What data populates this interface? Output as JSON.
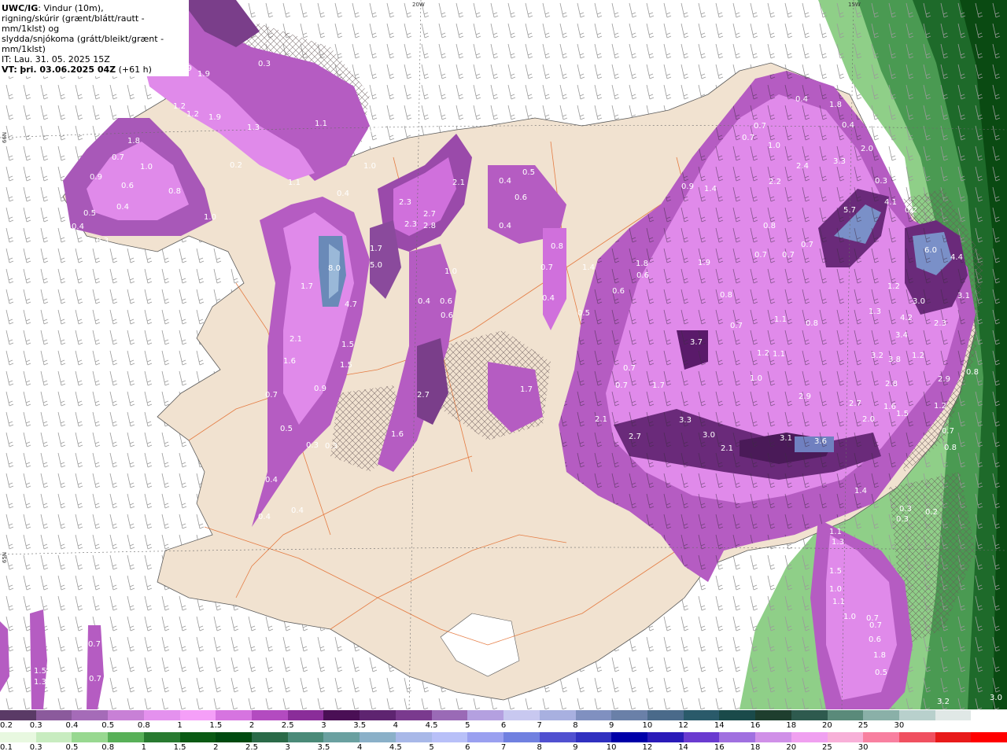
{
  "header": {
    "model": "UWC/IG",
    "line1_rest": ": Vindur (10m),",
    "line2": "rigning/skúrir (grænt/blátt/rautt - mm/1klst) og",
    "line3": "slydda/snjókoma (grátt/bleikt/grænt - mm/1klst)",
    "it_label": "IT:",
    "it_value": "Lau. 31. 05. 2025 15Z",
    "vt_label": "VT:",
    "vt_value": "þri. 03.06.2025 04Z",
    "vt_offset": "(+61 h)"
  },
  "graticule_labels": [
    "20W",
    "15W",
    "66N",
    "65N"
  ],
  "precip_values": [
    {
      "v": "0.3"
    },
    {
      "v": "1.9"
    },
    {
      "v": "1.9"
    },
    {
      "v": "1.2"
    },
    {
      "v": "1.2"
    },
    {
      "v": "1.9"
    },
    {
      "v": "1.3"
    },
    {
      "v": "1.1"
    },
    {
      "v": "0.9"
    },
    {
      "v": "1.8"
    },
    {
      "v": "0.7"
    },
    {
      "v": "1.0"
    },
    {
      "v": "0.9"
    },
    {
      "v": "0.6"
    },
    {
      "v": "0.8"
    },
    {
      "v": "0.2"
    },
    {
      "v": "1.1"
    },
    {
      "v": "0.5"
    },
    {
      "v": "0.4"
    },
    {
      "v": "0.4"
    },
    {
      "v": "0.3"
    },
    {
      "v": "1.0"
    },
    {
      "v": "1.0"
    },
    {
      "v": "0.4"
    },
    {
      "v": "2.3"
    },
    {
      "v": "2.7"
    },
    {
      "v": "2.3"
    },
    {
      "v": "2.8"
    },
    {
      "v": "2.1"
    },
    {
      "v": "0.4"
    },
    {
      "v": "0.5"
    },
    {
      "v": "0.6"
    },
    {
      "v": "0.4"
    },
    {
      "v": "8.0"
    },
    {
      "v": "4.7"
    },
    {
      "v": "5.0"
    },
    {
      "v": "1.7"
    },
    {
      "v": "1.7"
    },
    {
      "v": "2.1"
    },
    {
      "v": "1.6"
    },
    {
      "v": "1.5"
    },
    {
      "v": "1.5"
    },
    {
      "v": "0.9"
    },
    {
      "v": "0.7"
    },
    {
      "v": "0.5"
    },
    {
      "v": "0.3"
    },
    {
      "v": "0.3"
    },
    {
      "v": "0.4"
    },
    {
      "v": "0.4"
    },
    {
      "v": "0.4"
    },
    {
      "v": "1.0"
    },
    {
      "v": "0.4"
    },
    {
      "v": "0.6"
    },
    {
      "v": "0.6"
    },
    {
      "v": "2.7"
    },
    {
      "v": "1.6"
    },
    {
      "v": "1.7"
    },
    {
      "v": "0.8"
    },
    {
      "v": "0.7"
    },
    {
      "v": "0.4"
    },
    {
      "v": "1.4"
    },
    {
      "v": "0.5"
    },
    {
      "v": "0.6"
    },
    {
      "v": "1.8"
    },
    {
      "v": "0.6"
    },
    {
      "v": "0.9"
    },
    {
      "v": "1.4"
    },
    {
      "v": "1.9"
    },
    {
      "v": "0.8"
    },
    {
      "v": "0.7"
    },
    {
      "v": "1.1"
    },
    {
      "v": "0.8"
    },
    {
      "v": "3.7"
    },
    {
      "v": "0.7"
    },
    {
      "v": "0.7"
    },
    {
      "v": "1.7"
    },
    {
      "v": "2.1"
    },
    {
      "v": "2.7"
    },
    {
      "v": "3.3"
    },
    {
      "v": "3.0"
    },
    {
      "v": "2.1"
    },
    {
      "v": "3.1"
    },
    {
      "v": "3.6"
    },
    {
      "v": "1.2"
    },
    {
      "v": "1.1"
    },
    {
      "v": "1.0"
    },
    {
      "v": "2.9"
    },
    {
      "v": "2.7"
    },
    {
      "v": "2.0"
    },
    {
      "v": "1.6"
    },
    {
      "v": "1.5"
    },
    {
      "v": "0.6"
    },
    {
      "v": "0.4"
    },
    {
      "v": "1.8"
    },
    {
      "v": "0.4"
    },
    {
      "v": "0.7"
    },
    {
      "v": "0.7"
    },
    {
      "v": "1.0"
    },
    {
      "v": "2.4"
    },
    {
      "v": "3.3"
    },
    {
      "v": "2.0"
    },
    {
      "v": "2.2"
    },
    {
      "v": "0.3"
    },
    {
      "v": "5.7"
    },
    {
      "v": "4.1"
    },
    {
      "v": "0.2"
    },
    {
      "v": "0.8"
    },
    {
      "v": "0.7"
    },
    {
      "v": "0.7"
    },
    {
      "v": "0.7"
    },
    {
      "v": "6.0"
    },
    {
      "v": "4.4"
    },
    {
      "v": "1.2"
    },
    {
      "v": "1.3"
    },
    {
      "v": "3.0"
    },
    {
      "v": "3.1"
    },
    {
      "v": "4.2"
    },
    {
      "v": "2.3"
    },
    {
      "v": "3.4"
    },
    {
      "v": "1.2"
    },
    {
      "v": "3.2"
    },
    {
      "v": "3.8"
    },
    {
      "v": "2.8"
    },
    {
      "v": "2.9"
    },
    {
      "v": "1.2"
    },
    {
      "v": "0.8"
    },
    {
      "v": "0.7"
    },
    {
      "v": "0.8"
    },
    {
      "v": "1.4"
    },
    {
      "v": "0.3"
    },
    {
      "v": "0.3"
    },
    {
      "v": "0.2"
    },
    {
      "v": "0.2"
    },
    {
      "v": "0.3"
    },
    {
      "v": "1.1"
    },
    {
      "v": "1.3"
    },
    {
      "v": "1.5"
    },
    {
      "v": "1.0"
    },
    {
      "v": "1.1"
    },
    {
      "v": "1.0"
    },
    {
      "v": "0.7"
    },
    {
      "v": "0.7"
    },
    {
      "v": "0.6"
    },
    {
      "v": "1.8"
    },
    {
      "v": "0.5"
    },
    {
      "v": "1.5"
    },
    {
      "v": "1.3"
    },
    {
      "v": "0.7"
    },
    {
      "v": "0.7"
    },
    {
      "v": "3.2"
    },
    {
      "v": "3.0"
    }
  ],
  "colorbar_upper": {
    "colors": [
      "#5a3a66",
      "#8b5a9c",
      "#a56bb8",
      "#c880d6",
      "#e491ee",
      "#f59ff8",
      "#d674e0",
      "#b34bc0",
      "#8a2d99",
      "#4a0f55",
      "#5e2470",
      "#7a3a8e",
      "#9a6ab6",
      "#b4a0e0",
      "#c8c8f0",
      "#a8b0e0",
      "#8090c0",
      "#6a80a8",
      "#4a6a8a",
      "#2a5a6a",
      "#1a4a4a",
      "#1e3e2e",
      "#2e5a4e",
      "#5a8a7a",
      "#8ab0a8",
      "#b8d0cc",
      "#e0e8e6",
      "#ffffff"
    ],
    "ticks": [
      "0.2",
      "0.3",
      "0.4",
      "0.5",
      "0.8",
      "1",
      "1.5",
      "2",
      "2.5",
      "3",
      "3.5",
      "4",
      "4.5",
      "5",
      "6",
      "7",
      "8",
      "9",
      "10",
      "12",
      "14",
      "16",
      "18",
      "20",
      "25",
      "30"
    ]
  },
  "colorbar_lower": {
    "colors": [
      "#e8f8e0",
      "#c8ecc0",
      "#98d890",
      "#58b058",
      "#287a30",
      "#0a5a14",
      "#004a10",
      "#2a6a48",
      "#4a8a78",
      "#6aa0a0",
      "#8ab0c8",
      "#a8b8e8",
      "#b8c0f8",
      "#9aa0f0",
      "#7080e0",
      "#5050d0",
      "#3030c0",
      "#0000a8",
      "#2a1ab8",
      "#6a3ad0",
      "#a070e0",
      "#d090e8",
      "#f0a0f0",
      "#f8b0d8",
      "#f880a0",
      "#f05060",
      "#e81a1a",
      "#ff0000"
    ],
    "ticks": [
      "0.1",
      "0.3",
      "0.5",
      "0.8",
      "1",
      "1.5",
      "2",
      "2.5",
      "3",
      "3.5",
      "4",
      "4.5",
      "5",
      "6",
      "7",
      "8",
      "9",
      "10",
      "12",
      "14",
      "16",
      "18",
      "20",
      "25",
      "30"
    ]
  }
}
